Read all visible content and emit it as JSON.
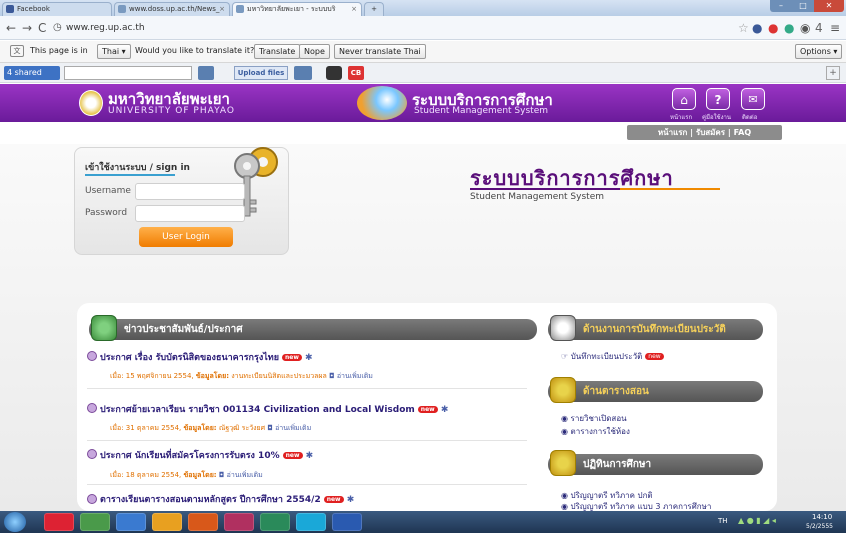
{
  "browser": {
    "tabs": [
      {
        "label": "Facebook",
        "color": "#3b5998"
      },
      {
        "label": "www.doss.up.ac.th/News_",
        "color": "#7a9ac0"
      },
      {
        "label": "มหาวิทยาลัยพะเยา - ระบบบริ",
        "color": "#7a9ac0"
      }
    ],
    "url": "www.reg.up.ac.th",
    "translate_bar": {
      "message_before": "This page is in",
      "language": "Thai",
      "message_after": "Would you like to translate it?",
      "translate_btn": "Translate",
      "nope_btn": "Nope",
      "never_btn": "Never translate Thai",
      "options_btn": "Options"
    },
    "toolbar": {
      "shared_label": "4 shared",
      "upload_label": "Upload files",
      "cb_label": "CB"
    }
  },
  "site": {
    "university_th": "มหาวิทยาลัยพะเยา",
    "university_en": "UNIVERSITY OF PHAYAO",
    "system_th": "ระบบบริการการศึกษา",
    "system_en": "Student Management System",
    "top_icons": [
      "หน้าแรก",
      "คู่มือใช้งาน",
      "ติดต่อ"
    ],
    "sub_nav": [
      "หน้าแรก",
      "รับสมัคร",
      "FAQ"
    ],
    "login": {
      "title": "เข้าใช้งานระบบ / sign in",
      "username_label": "Username",
      "password_label": "Password",
      "button": "User Login"
    },
    "main_title": "ระบบบริการการศึกษา",
    "main_subtitle": "Student Management System",
    "news": {
      "header": "ข่าวประชาสัมพันธ์/ประกาศ",
      "items": [
        {
          "title": "ประกาศ เรื่อง รับบัตรนิสิตของธนาคารกรุงไทย",
          "date": "เมื่อ: 15 พฤศจิกายน 2554,",
          "by_label": "ข้อมูลโดย:",
          "by": "งานทะเบียนนิสิตและประมวลผล",
          "more": "อ่านเพิ่มเติม"
        },
        {
          "title": "ประกาศย้ายเวลาเรียน รายวิชา 001134 Civilization and Local Wisdom",
          "date": "เมื่อ: 31 ตุลาคม 2554,",
          "by_label": "ข้อมูลโดย:",
          "by": "ณัฐวุฒิ ระวังยศ",
          "more": "อ่านเพิ่มเติม"
        },
        {
          "title": "ประกาศ นักเรียนที่สมัครโครงการรับตรง 10%",
          "date": "เมื่อ: 18 ตุลาคม 2554,",
          "by_label": "ข้อมูลโดย:",
          "by": "",
          "more": "อ่านเพิ่มเติม"
        },
        {
          "title": "ตารางเรียนตารางสอนตามหลักสูตร ปีการศึกษา 2554/2",
          "date": "",
          "by_label": "",
          "by": "",
          "more": ""
        }
      ],
      "new_badge": "new"
    },
    "right": {
      "section1": "ด้านงานการบันทึกทะเบียนประวัติ",
      "section1_links": [
        "บันทึกทะเบียนประวัติ"
      ],
      "section2": "ด้านตารางสอน",
      "section2_links": [
        "รายวิชาเปิดสอน",
        "ตารางการใช้ห้อง"
      ],
      "section3": "ปฏิทินการศึกษา",
      "section3_links": [
        "ปริญญาตรี ทวิภาค ปกติ",
        "ปริญญาตรี ทวิภาค แบบ 3 ภาคการศึกษา"
      ]
    }
  },
  "taskbar": {
    "lang": "TH",
    "time": "14:10",
    "date": "5/2/2555"
  }
}
